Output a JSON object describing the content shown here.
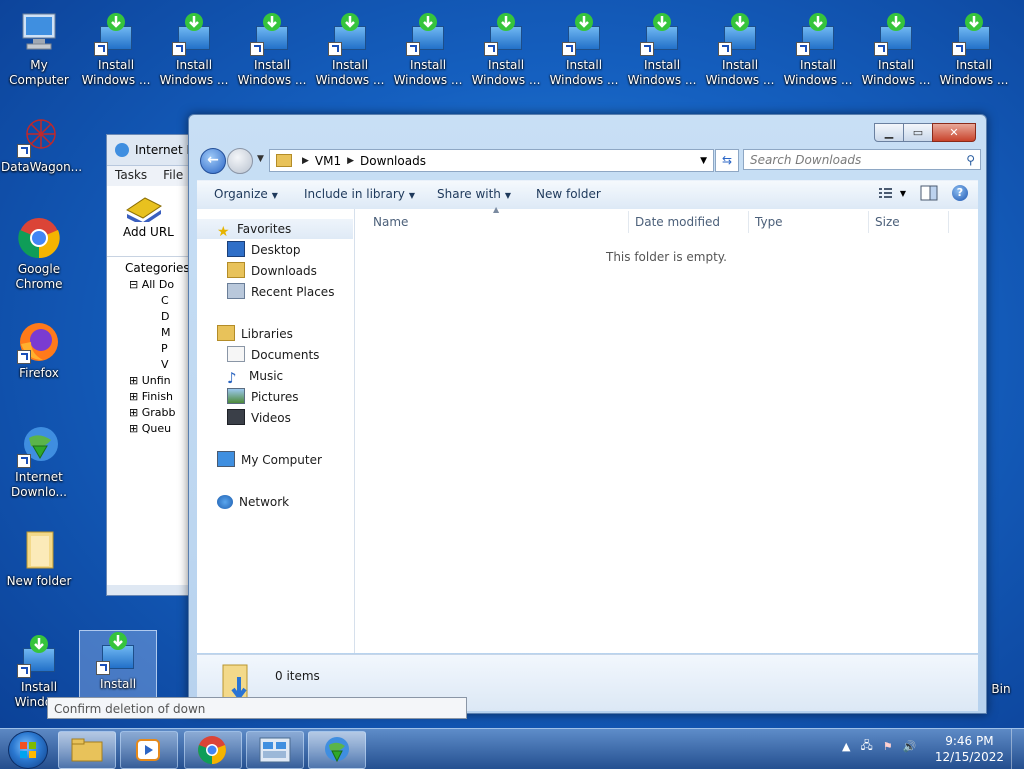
{
  "desktop": {
    "icons": {
      "my_computer": "My Computer",
      "datawagon": "DataWagon...",
      "chrome": "Google Chrome",
      "firefox": "Firefox",
      "idm": "Internet Downlo...",
      "new_folder": "New folder",
      "install_line1": "Install",
      "install_line2": "Windows ...",
      "install_partial": "Install Windo...",
      "recycle": "Bin"
    }
  },
  "idm_window": {
    "title": "Internet D",
    "menu": [
      "Tasks",
      "File"
    ],
    "add_url": "Add URL",
    "categories_label": "Categories",
    "tree": [
      "All Do",
      "C",
      "D",
      "M",
      "P",
      "V",
      "Unfin",
      "Finish",
      "Grabb",
      "Queu"
    ]
  },
  "explorer": {
    "address": {
      "root": "VM1",
      "current": "Downloads"
    },
    "search_placeholder": "Search Downloads",
    "commands": {
      "organize": "Organize",
      "include": "Include in library",
      "share": "Share with",
      "new_folder": "New folder"
    },
    "nav": {
      "favorites": "Favorites",
      "desktop": "Desktop",
      "downloads": "Downloads",
      "recent": "Recent Places",
      "libraries": "Libraries",
      "documents": "Documents",
      "music": "Music",
      "pictures": "Pictures",
      "videos": "Videos",
      "my_computer": "My Computer",
      "network": "Network"
    },
    "columns": {
      "name": "Name",
      "date": "Date modified",
      "type": "Type",
      "size": "Size"
    },
    "empty_message": "This folder is empty.",
    "item_count": "0 items"
  },
  "tooltip": "Confirm deletion of down",
  "taskbar": {
    "time": "9:46 PM",
    "date": "12/15/2022"
  },
  "colors": {
    "accent": "#2b66c6",
    "desktop": "#1560c0"
  }
}
